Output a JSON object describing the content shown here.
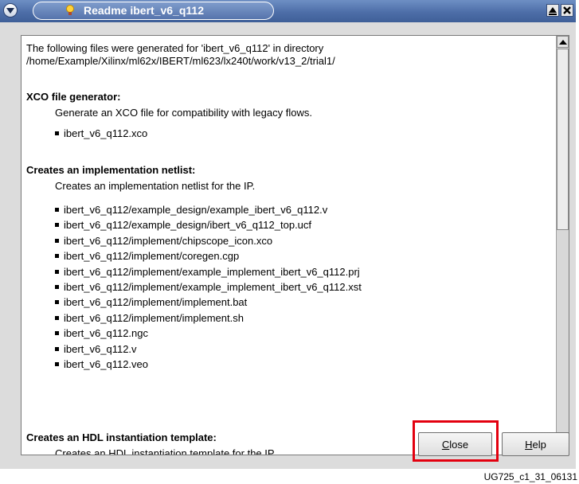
{
  "window": {
    "title": "Readme ibert_v6_q112"
  },
  "intro": {
    "line1": "The following files were generated for 'ibert_v6_q112' in directory",
    "line2": "/home/Example/Xilinx/ml62x/IBERT/ml623/lx240t/work/v13_2/trial1/"
  },
  "sections": {
    "xco": {
      "title": "XCO file generator:",
      "description": "Generate an XCO file for compatibility with legacy flows.",
      "files": [
        "ibert_v6_q112.xco"
      ]
    },
    "netlist": {
      "title": "Creates an implementation netlist:",
      "description": "Creates an implementation netlist for the IP.",
      "files": [
        "ibert_v6_q112/example_design/example_ibert_v6_q112.v",
        "ibert_v6_q112/example_design/ibert_v6_q112_top.ucf",
        "ibert_v6_q112/implement/chipscope_icon.xco",
        "ibert_v6_q112/implement/coregen.cgp",
        "ibert_v6_q112/implement/example_implement_ibert_v6_q112.prj",
        "ibert_v6_q112/implement/example_implement_ibert_v6_q112.xst",
        "ibert_v6_q112/implement/implement.bat",
        "ibert_v6_q112/implement/implement.sh",
        "ibert_v6_q112.ngc",
        "ibert_v6_q112.v",
        "ibert_v6_q112.veo"
      ]
    },
    "hdl": {
      "title": "Creates an HDL instantiation template:",
      "description": "Creates an HDL instantiation template for the IP."
    }
  },
  "buttons": {
    "close_mnemonic": "C",
    "close_rest": "lose",
    "help_mnemonic": "H",
    "help_rest": "elp"
  },
  "caption": "UG725_c1_31_06131",
  "colors": {
    "titlebar": "#4d6ea8",
    "highlight": "#e3000f"
  },
  "icons": [
    "window-menu-icon",
    "bulb-icon",
    "maximize-icon",
    "close-icon",
    "scroll-up-icon",
    "scroll-down-icon"
  ]
}
